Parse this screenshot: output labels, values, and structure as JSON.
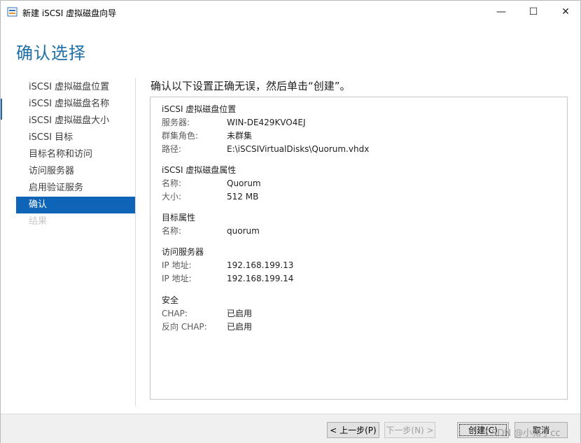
{
  "window": {
    "title": "新建 iSCSI 虚拟磁盘向导",
    "minimize_glyph": "—",
    "maximize_glyph": "☐",
    "close_glyph": "✕"
  },
  "page": {
    "heading": "确认选择",
    "instruction": "确认以下设置正确无误，然后单击“创建”。"
  },
  "nav": {
    "items": [
      {
        "label": "iSCSI 虚拟磁盘位置",
        "state": "normal"
      },
      {
        "label": "iSCSI 虚拟磁盘名称",
        "state": "normal"
      },
      {
        "label": "iSCSI 虚拟磁盘大小",
        "state": "normal"
      },
      {
        "label": "iSCSI 目标",
        "state": "normal"
      },
      {
        "label": "目标名称和访问",
        "state": "normal"
      },
      {
        "label": "访问服务器",
        "state": "normal"
      },
      {
        "label": "启用验证服务",
        "state": "normal"
      },
      {
        "label": "确认",
        "state": "active"
      },
      {
        "label": "结果",
        "state": "disabled"
      }
    ]
  },
  "summary": {
    "location": {
      "title": "iSCSI 虚拟磁盘位置",
      "server_label": "服务器:",
      "server_value": "WIN-DE429KVO4EJ",
      "cluster_label": "群集角色:",
      "cluster_value": "未群集",
      "path_label": "路径:",
      "path_value": "E:\\iSCSIVirtualDisks\\Quorum.vhdx"
    },
    "properties": {
      "title": "iSCSI 虚拟磁盘属性",
      "name_label": "名称:",
      "name_value": "Quorum",
      "size_label": "大小:",
      "size_value": "512 MB"
    },
    "target": {
      "title": "目标属性",
      "name_label": "名称:",
      "name_value": "quorum"
    },
    "access": {
      "title": "访问服务器",
      "ip1_label": "IP 地址:",
      "ip1_value": "192.168.199.13",
      "ip2_label": "IP 地址:",
      "ip2_value": "192.168.199.14"
    },
    "security": {
      "title": "安全",
      "chap_label": "CHAP:",
      "chap_value": "已启用",
      "rchap_label": "反向 CHAP:",
      "rchap_value": "已启用"
    }
  },
  "buttons": {
    "prev": "< 上一步(P)",
    "next": "下一步(N) >",
    "create": "创建(C)",
    "cancel": "取消"
  },
  "watermark": "CSDN @小猪丁cc",
  "colors": {
    "accent": "#0e64b6",
    "heading": "#1e6fa8"
  }
}
